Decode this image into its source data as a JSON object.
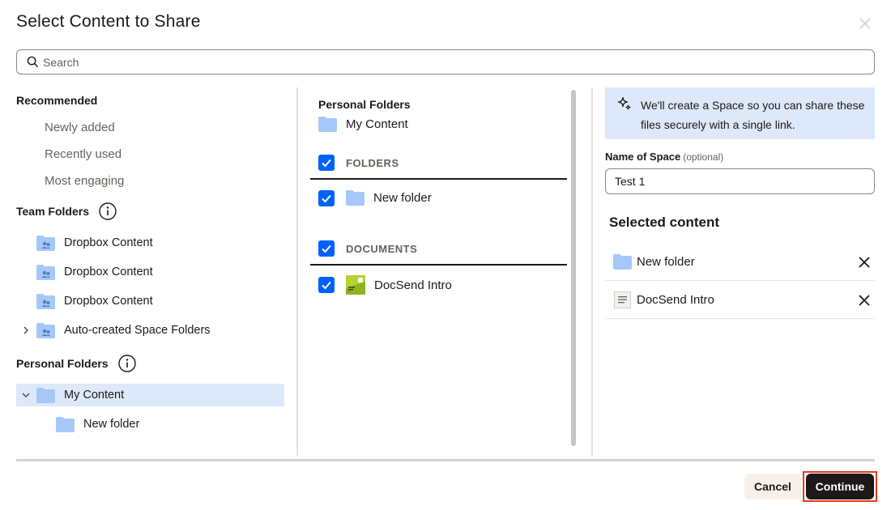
{
  "dialog": {
    "title": "Select Content to Share"
  },
  "search": {
    "placeholder": "Search"
  },
  "left": {
    "recommended_header": "Recommended",
    "recommended_items": [
      "Newly added",
      "Recently used",
      "Most engaging"
    ],
    "team_folders_header": "Team Folders",
    "team_folders": [
      "Dropbox Content",
      "Dropbox Content",
      "Dropbox Content",
      "Auto-created Space Folders"
    ],
    "personal_folders_header": "Personal Folders",
    "personal_folders": [
      "My Content",
      "New folder"
    ]
  },
  "middle": {
    "header": "Personal Folders",
    "current_folder": "My Content",
    "folders_group": "FOLDERS",
    "folders": [
      "New folder"
    ],
    "documents_group": "DOCUMENTS",
    "documents": [
      "DocSend Intro"
    ]
  },
  "right": {
    "banner_text": "We'll create a Space so you can share these files securely with a single link.",
    "name_label": "Name of Space",
    "name_optional": "(optional)",
    "name_value": "Test 1",
    "selected_header": "Selected content",
    "selected_items": [
      "New folder",
      "DocSend Intro"
    ]
  },
  "footer": {
    "cancel_label": "Cancel",
    "continue_label": "Continue"
  },
  "colors": {
    "accent": "#0061fe",
    "folder": "#a5c8f8",
    "highlight": "#e8381c"
  }
}
